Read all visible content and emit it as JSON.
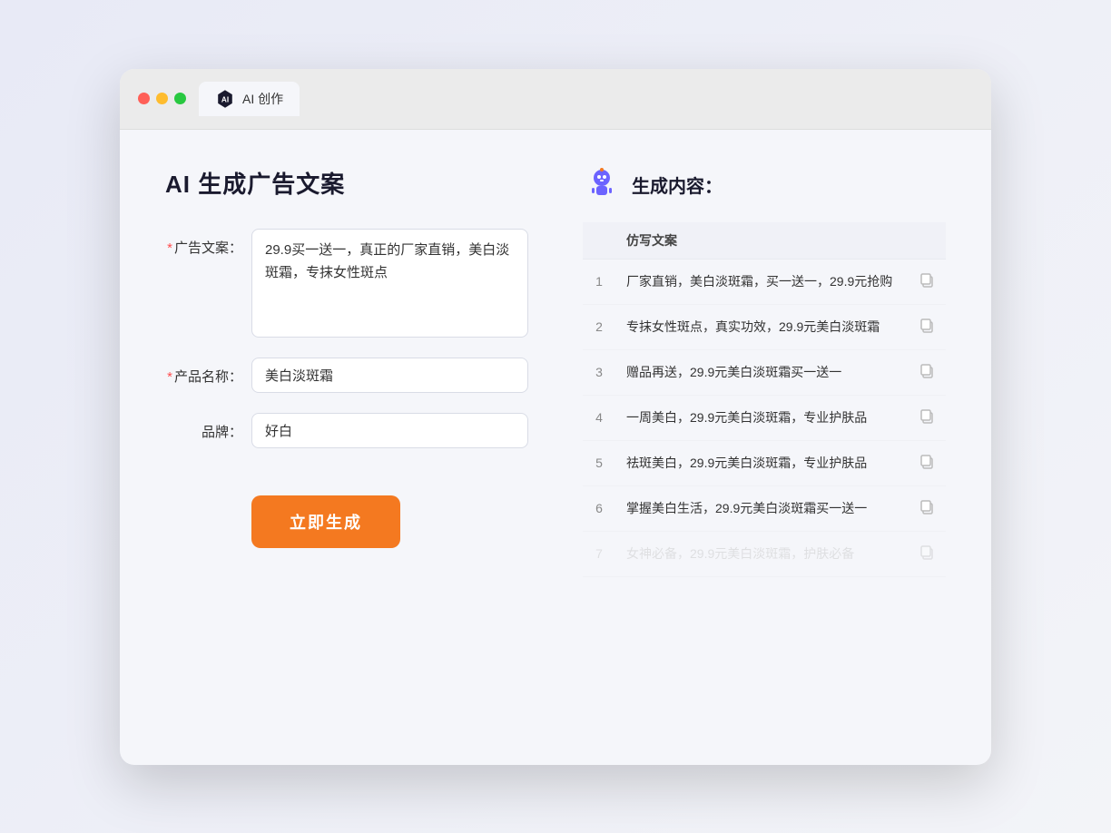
{
  "window": {
    "tab_icon_alt": "AI icon",
    "tab_label": "AI 创作"
  },
  "left_panel": {
    "title": "AI 生成广告文案",
    "ad_copy_label": "广告文案：",
    "ad_copy_required": true,
    "ad_copy_value": "29.9买一送一，真正的厂家直销，美白淡斑霜，专抹女性斑点",
    "product_name_label": "产品名称：",
    "product_name_required": true,
    "product_name_value": "美白淡斑霜",
    "brand_label": "品牌：",
    "brand_required": false,
    "brand_value": "好白",
    "generate_button": "立即生成"
  },
  "right_panel": {
    "title": "生成内容：",
    "column_header": "仿写文案",
    "results": [
      {
        "num": "1",
        "text": "厂家直销，美白淡斑霜，买一送一，29.9元抢购",
        "faded": false
      },
      {
        "num": "2",
        "text": "专抹女性斑点，真实功效，29.9元美白淡斑霜",
        "faded": false
      },
      {
        "num": "3",
        "text": "赠品再送，29.9元美白淡斑霜买一送一",
        "faded": false
      },
      {
        "num": "4",
        "text": "一周美白，29.9元美白淡斑霜，专业护肤品",
        "faded": false
      },
      {
        "num": "5",
        "text": "祛斑美白，29.9元美白淡斑霜，专业护肤品",
        "faded": false
      },
      {
        "num": "6",
        "text": "掌握美白生活，29.9元美白淡斑霜买一送一",
        "faded": false
      },
      {
        "num": "7",
        "text": "女神必备，29.9元美白淡斑霜，护肤必备",
        "faded": true
      }
    ]
  }
}
